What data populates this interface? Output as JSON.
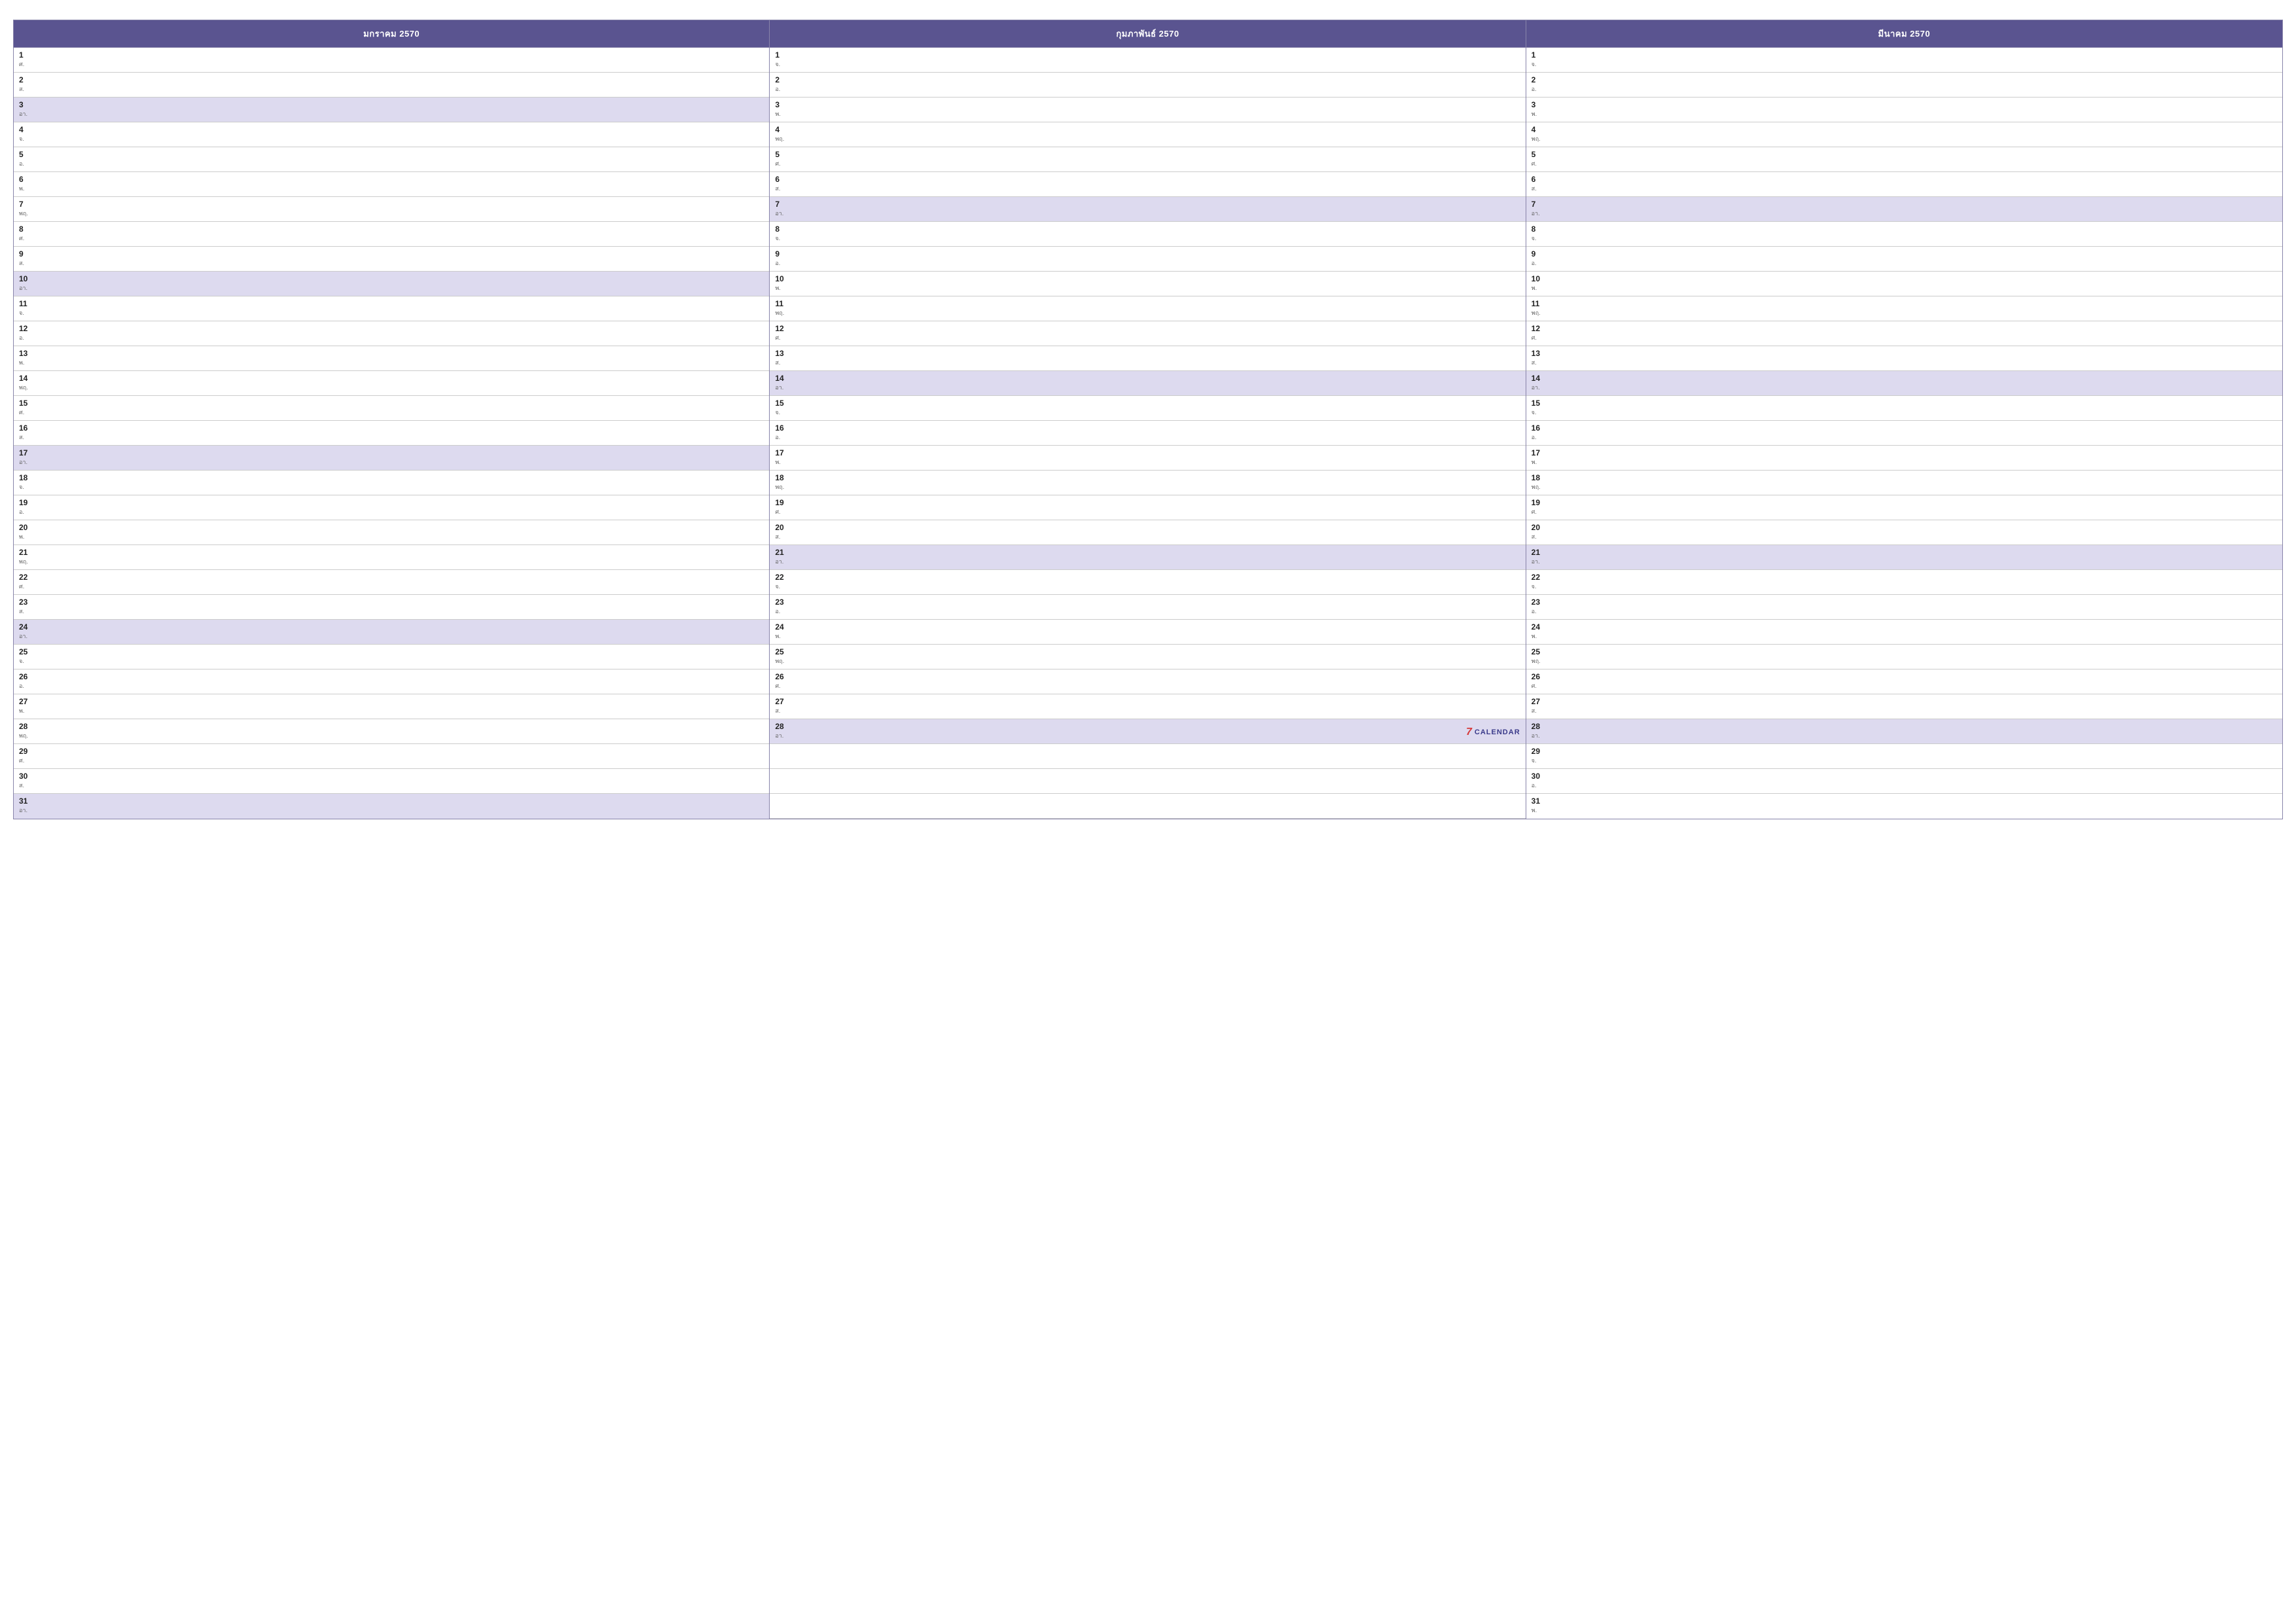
{
  "months": [
    {
      "name": "มกราคม 2570",
      "days": [
        {
          "num": "1",
          "abbr": "ศ."
        },
        {
          "num": "2",
          "abbr": "ส."
        },
        {
          "num": "3",
          "abbr": "อา.",
          "highlight": true
        },
        {
          "num": "4",
          "abbr": "จ."
        },
        {
          "num": "5",
          "abbr": "อ."
        },
        {
          "num": "6",
          "abbr": "พ."
        },
        {
          "num": "7",
          "abbr": "พฤ."
        },
        {
          "num": "8",
          "abbr": "ศ."
        },
        {
          "num": "9",
          "abbr": "ส."
        },
        {
          "num": "10",
          "abbr": "อา.",
          "highlight": true
        },
        {
          "num": "11",
          "abbr": "จ."
        },
        {
          "num": "12",
          "abbr": "อ."
        },
        {
          "num": "13",
          "abbr": "พ."
        },
        {
          "num": "14",
          "abbr": "พฤ."
        },
        {
          "num": "15",
          "abbr": "ศ."
        },
        {
          "num": "16",
          "abbr": "ส."
        },
        {
          "num": "17",
          "abbr": "อา.",
          "highlight": true
        },
        {
          "num": "18",
          "abbr": "จ."
        },
        {
          "num": "19",
          "abbr": "อ."
        },
        {
          "num": "20",
          "abbr": "พ."
        },
        {
          "num": "21",
          "abbr": "พฤ."
        },
        {
          "num": "22",
          "abbr": "ศ."
        },
        {
          "num": "23",
          "abbr": "ส."
        },
        {
          "num": "24",
          "abbr": "อา.",
          "highlight": true
        },
        {
          "num": "25",
          "abbr": "จ."
        },
        {
          "num": "26",
          "abbr": "อ."
        },
        {
          "num": "27",
          "abbr": "พ."
        },
        {
          "num": "28",
          "abbr": "พฤ."
        },
        {
          "num": "29",
          "abbr": "ศ."
        },
        {
          "num": "30",
          "abbr": "ส."
        },
        {
          "num": "31",
          "abbr": "อา.",
          "highlight": true
        }
      ]
    },
    {
      "name": "กุมภาพันธ์ 2570",
      "days": [
        {
          "num": "1",
          "abbr": "จ."
        },
        {
          "num": "2",
          "abbr": "อ."
        },
        {
          "num": "3",
          "abbr": "พ."
        },
        {
          "num": "4",
          "abbr": "พฤ."
        },
        {
          "num": "5",
          "abbr": "ศ."
        },
        {
          "num": "6",
          "abbr": "ส."
        },
        {
          "num": "7",
          "abbr": "อา.",
          "highlight": true
        },
        {
          "num": "8",
          "abbr": "จ."
        },
        {
          "num": "9",
          "abbr": "อ."
        },
        {
          "num": "10",
          "abbr": "พ."
        },
        {
          "num": "11",
          "abbr": "พฤ."
        },
        {
          "num": "12",
          "abbr": "ศ."
        },
        {
          "num": "13",
          "abbr": "ส."
        },
        {
          "num": "14",
          "abbr": "อา.",
          "highlight": true
        },
        {
          "num": "15",
          "abbr": "จ."
        },
        {
          "num": "16",
          "abbr": "อ."
        },
        {
          "num": "17",
          "abbr": "พ."
        },
        {
          "num": "18",
          "abbr": "พฤ."
        },
        {
          "num": "19",
          "abbr": "ศ."
        },
        {
          "num": "20",
          "abbr": "ส."
        },
        {
          "num": "21",
          "abbr": "อา.",
          "highlight": true
        },
        {
          "num": "22",
          "abbr": "จ."
        },
        {
          "num": "23",
          "abbr": "อ."
        },
        {
          "num": "24",
          "abbr": "พ."
        },
        {
          "num": "25",
          "abbr": "พฤ."
        },
        {
          "num": "26",
          "abbr": "ศ."
        },
        {
          "num": "27",
          "abbr": "ส."
        },
        {
          "num": "28",
          "abbr": "อา.",
          "highlight": true
        }
      ],
      "watermark": true
    },
    {
      "name": "มีนาคม 2570",
      "days": [
        {
          "num": "1",
          "abbr": "จ."
        },
        {
          "num": "2",
          "abbr": "อ."
        },
        {
          "num": "3",
          "abbr": "พ."
        },
        {
          "num": "4",
          "abbr": "พฤ."
        },
        {
          "num": "5",
          "abbr": "ศ."
        },
        {
          "num": "6",
          "abbr": "ส."
        },
        {
          "num": "7",
          "abbr": "อา.",
          "highlight": true
        },
        {
          "num": "8",
          "abbr": "จ."
        },
        {
          "num": "9",
          "abbr": "อ."
        },
        {
          "num": "10",
          "abbr": "พ."
        },
        {
          "num": "11",
          "abbr": "พฤ."
        },
        {
          "num": "12",
          "abbr": "ศ."
        },
        {
          "num": "13",
          "abbr": "ส."
        },
        {
          "num": "14",
          "abbr": "อา.",
          "highlight": true
        },
        {
          "num": "15",
          "abbr": "จ."
        },
        {
          "num": "16",
          "abbr": "อ."
        },
        {
          "num": "17",
          "abbr": "พ."
        },
        {
          "num": "18",
          "abbr": "พฤ."
        },
        {
          "num": "19",
          "abbr": "ศ."
        },
        {
          "num": "20",
          "abbr": "ส."
        },
        {
          "num": "21",
          "abbr": "อา.",
          "highlight": true
        },
        {
          "num": "22",
          "abbr": "จ."
        },
        {
          "num": "23",
          "abbr": "อ."
        },
        {
          "num": "24",
          "abbr": "พ."
        },
        {
          "num": "25",
          "abbr": "พฤ."
        },
        {
          "num": "26",
          "abbr": "ศ."
        },
        {
          "num": "27",
          "abbr": "ส."
        },
        {
          "num": "28",
          "abbr": "อา.",
          "highlight": true
        },
        {
          "num": "29",
          "abbr": "จ."
        },
        {
          "num": "30",
          "abbr": "อ."
        },
        {
          "num": "31",
          "abbr": "พ."
        }
      ]
    }
  ],
  "watermark": {
    "number": "7",
    "text": "CALENDAR"
  }
}
